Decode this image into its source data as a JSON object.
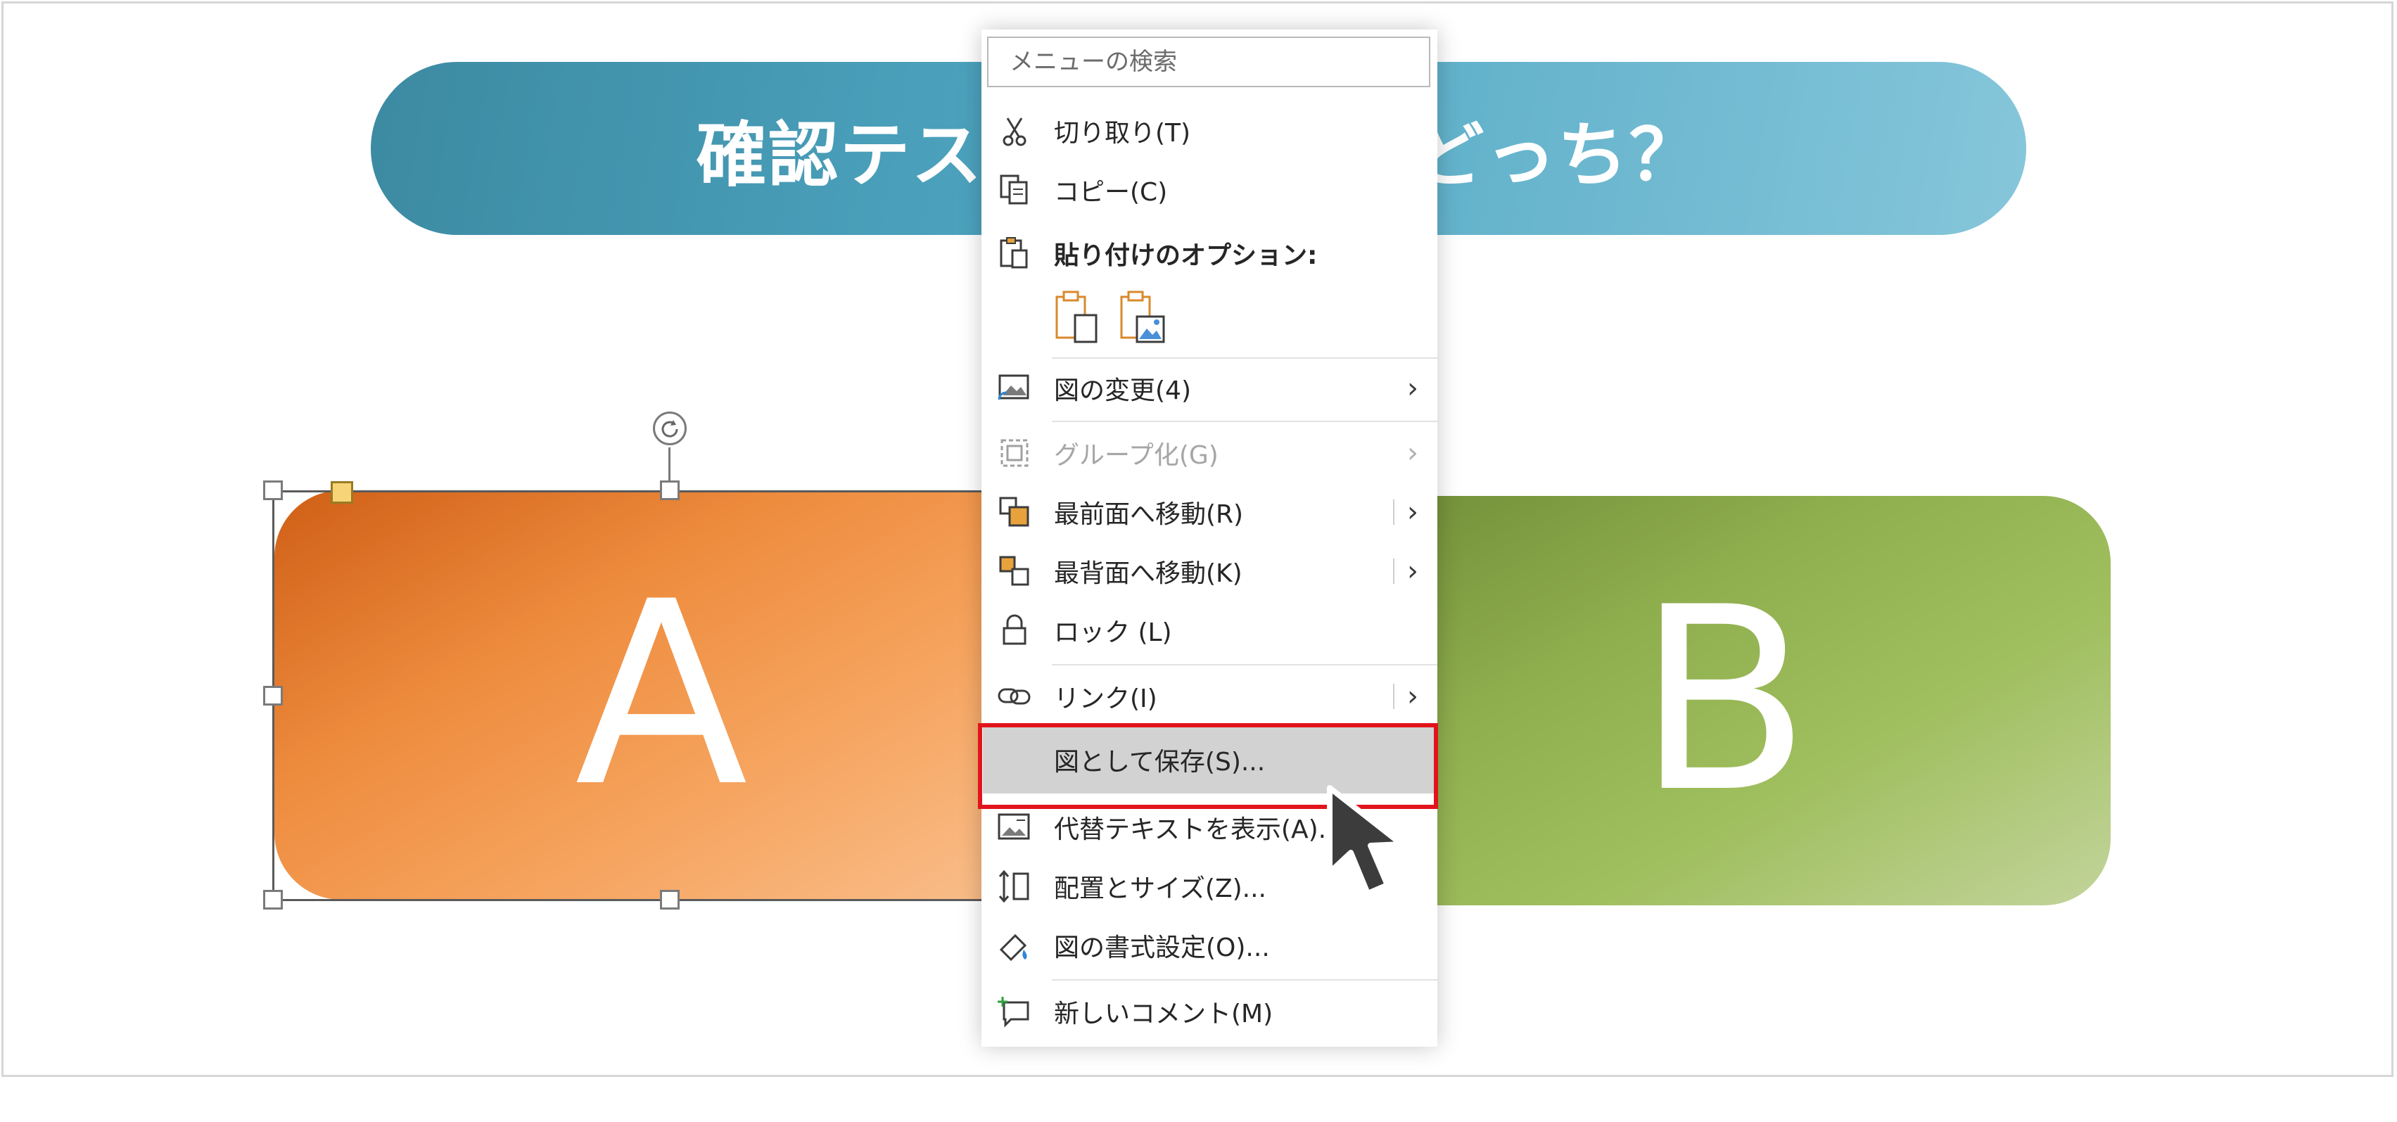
{
  "slide": {
    "title": "確認テスト　　　　　どっち？",
    "box_a_letter": "A",
    "box_b_letter": "B"
  },
  "menu": {
    "search_placeholder": "メニューの検索",
    "items": [
      {
        "label": "切り取り(T)",
        "icon": "scissors-icon",
        "submenu": false
      },
      {
        "label": "コピー(C)",
        "icon": "copy-icon",
        "submenu": false
      },
      {
        "label": "貼り付けのオプション:",
        "icon": "paste-icon",
        "submenu": false
      },
      {
        "label": "図の変更(4)",
        "icon": "change-picture-icon",
        "submenu": true
      },
      {
        "label": "グループ化(G)",
        "icon": "group-icon",
        "submenu": true,
        "disabled": true
      },
      {
        "label": "最前面へ移動(R)",
        "icon": "bring-to-front-icon",
        "submenu": true
      },
      {
        "label": "最背面へ移動(K)",
        "icon": "send-to-back-icon",
        "submenu": true
      },
      {
        "label": "ロック (L)",
        "icon": "lock-icon",
        "submenu": false
      },
      {
        "label": "リンク(I)",
        "icon": "link-icon",
        "submenu": true
      },
      {
        "label": "図として保存(S)...",
        "icon": "",
        "submenu": false,
        "highlighted": true
      },
      {
        "label": "代替テキストを表示(A)...",
        "icon": "alt-text-icon",
        "submenu": false
      },
      {
        "label": "配置とサイズ(Z)...",
        "icon": "size-position-icon",
        "submenu": false
      },
      {
        "label": "図の書式設定(O)...",
        "icon": "format-picture-icon",
        "submenu": false
      },
      {
        "label": "新しいコメント(M)",
        "icon": "new-comment-icon",
        "submenu": false
      }
    ]
  },
  "colors": {
    "accent_red": "#e1141c",
    "title_blue": "#4fa7c3",
    "box_orange": "#ee8c3e",
    "box_green": "#8fae4e"
  }
}
